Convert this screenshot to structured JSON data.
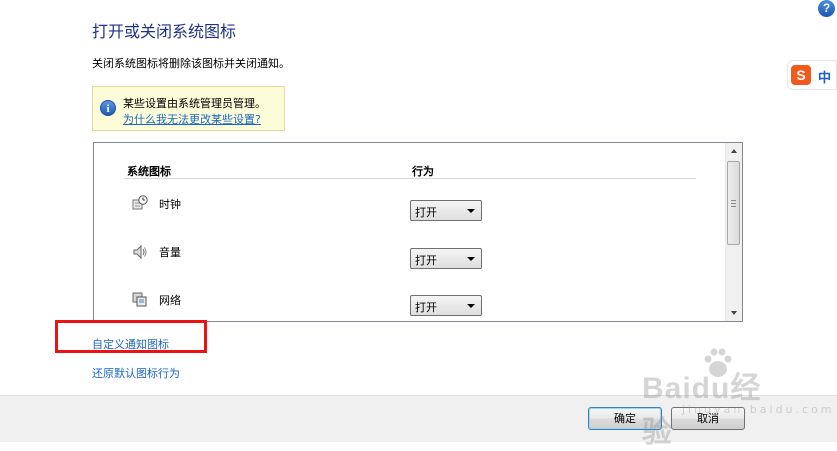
{
  "header": {
    "title": "打开或关闭系统图标",
    "description": "关闭系统图标将删除该图标并关闭通知。"
  },
  "info_box": {
    "text": "某些设置由系统管理员管理。",
    "link": "为什么我无法更改某些设置?"
  },
  "table": {
    "columns": {
      "icon": "系统图标",
      "behavior": "行为"
    },
    "rows": [
      {
        "label": "时钟",
        "icon": "clock-icon",
        "value": "打开"
      },
      {
        "label": "音量",
        "icon": "volume-icon",
        "value": "打开"
      },
      {
        "label": "网络",
        "icon": "network-icon",
        "value": "打开"
      }
    ]
  },
  "links": {
    "customize": "自定义通知图标",
    "restore": "还原默认图标行为"
  },
  "buttons": {
    "ok": "确定",
    "cancel": "取消"
  },
  "ime": {
    "badge": "S",
    "lang": "中"
  },
  "help": {
    "symbol": "?"
  },
  "watermark": {
    "text": "Baidu经验",
    "sub": "jingyan.baidu.com"
  },
  "colors": {
    "title": "#1e3287",
    "link": "#1a66c2",
    "highlight": "#ee1111"
  }
}
